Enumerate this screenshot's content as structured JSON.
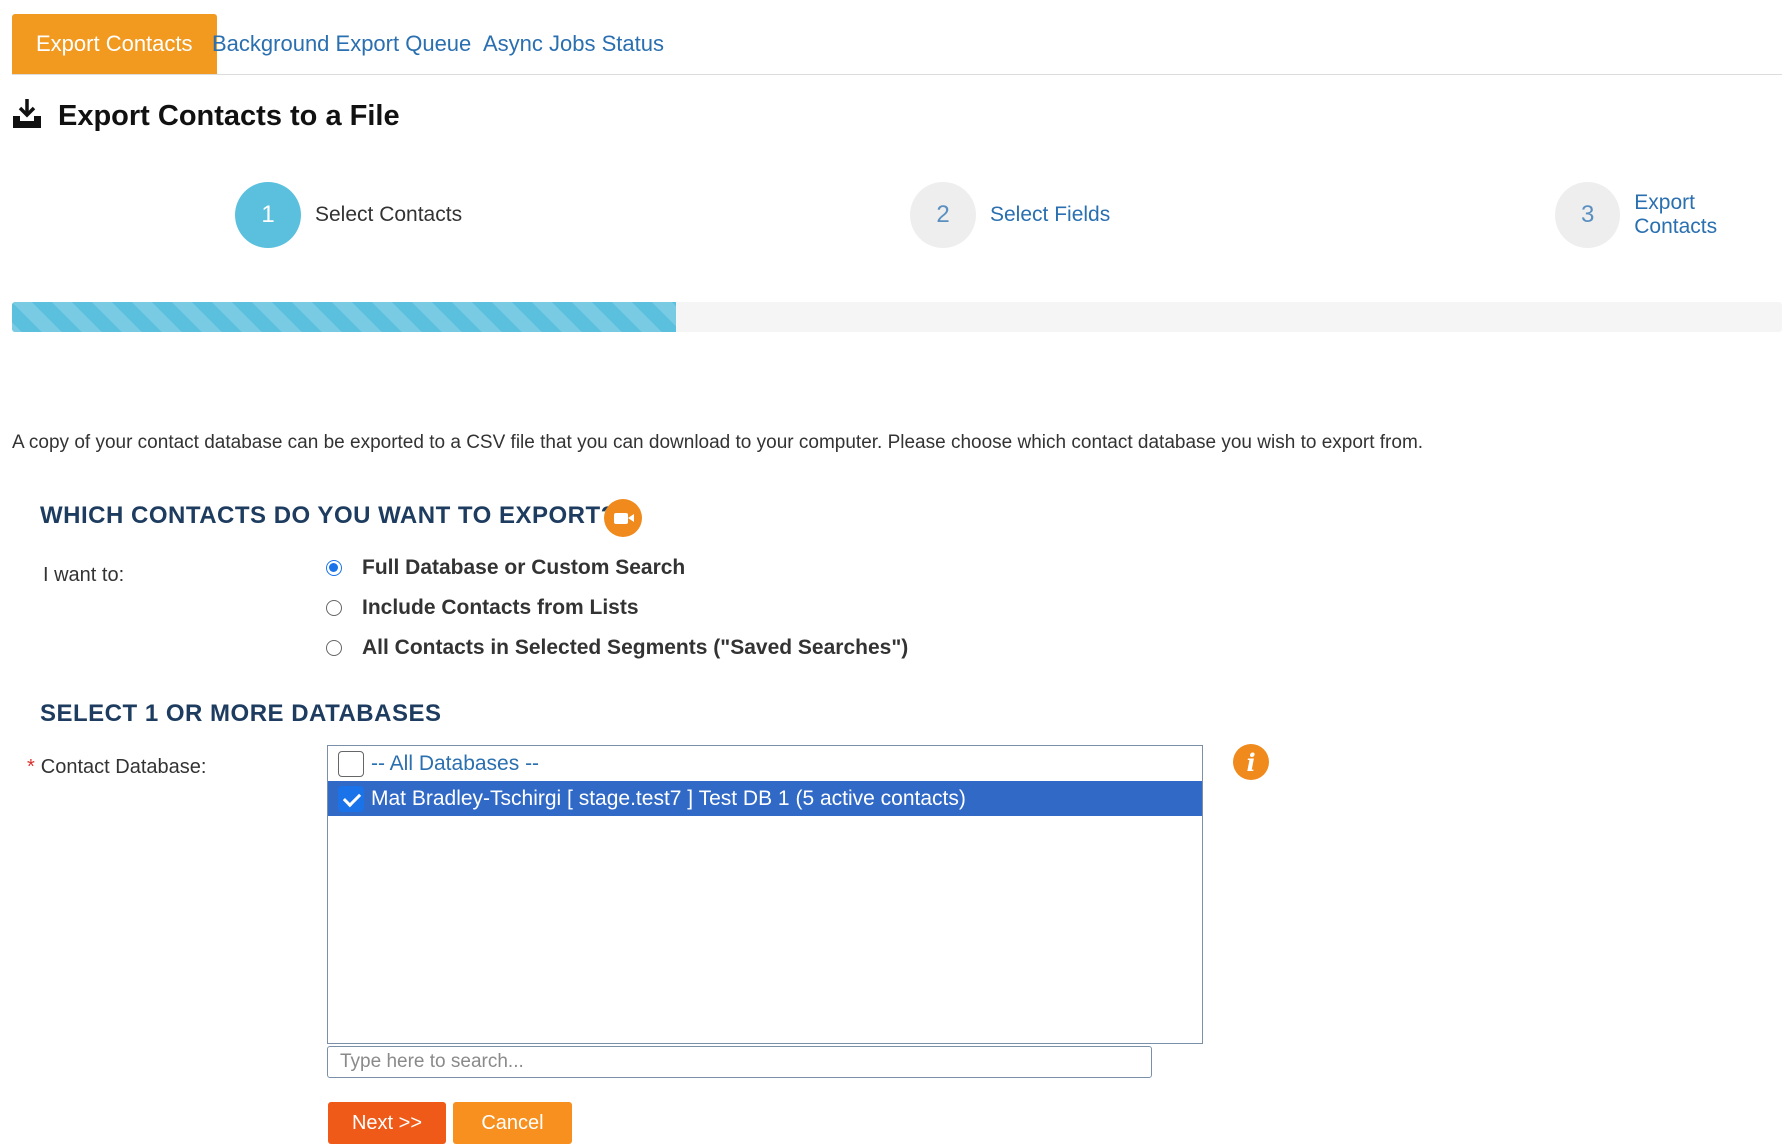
{
  "tabs": [
    {
      "label": "Export Contacts",
      "active": true
    },
    {
      "label": "Background Export Queue",
      "active": false
    },
    {
      "label": "Async Jobs Status",
      "active": false
    }
  ],
  "page": {
    "icon": "download-tray-icon",
    "title": "Export Contacts to a File"
  },
  "steps": [
    {
      "number": "1",
      "label": "Select Contacts",
      "state": "active"
    },
    {
      "number": "2",
      "label": "Select Fields",
      "state": "inactive"
    },
    {
      "number": "3",
      "label": "Export Contacts",
      "state": "inactive"
    }
  ],
  "progress": {
    "fraction": 0.375,
    "color": "#5bc0de"
  },
  "intro_text": "A copy of your contact database can be exported to a CSV file that you can download to your computer. Please choose which contact database you wish to export from.",
  "which_section": {
    "heading": "WHICH CONTACTS DO YOU WANT TO EXPORT?",
    "video_icon": "video-camera-icon",
    "field_label": "I want to:",
    "options": [
      {
        "label": "Full Database or Custom Search",
        "checked": true
      },
      {
        "label": "Include Contacts from Lists",
        "checked": false
      },
      {
        "label": "All Contacts in Selected Segments (\"Saved Searches\")",
        "checked": false
      }
    ]
  },
  "db_section": {
    "heading": "SELECT 1 OR MORE DATABASES",
    "required_mark": "*",
    "field_label": "Contact Database:",
    "items": [
      {
        "label": "-- All Databases --",
        "checked": false,
        "selected": false
      },
      {
        "label": "Mat Bradley-Tschirgi [ stage.test7 ] Test DB 1 (5 active contacts)",
        "checked": true,
        "selected": true
      }
    ],
    "info_icon": "info-icon",
    "info_glyph": "i",
    "search_placeholder": "Type here to search..."
  },
  "actions": {
    "next_label": "Next >>",
    "cancel_label": "Cancel"
  },
  "colors": {
    "accent_orange": "#f29a1f",
    "next_button": "#ef5a18",
    "heading_navy": "#1d3c5f",
    "link_blue": "#2a6fb0",
    "selected_row": "#3169c6"
  }
}
